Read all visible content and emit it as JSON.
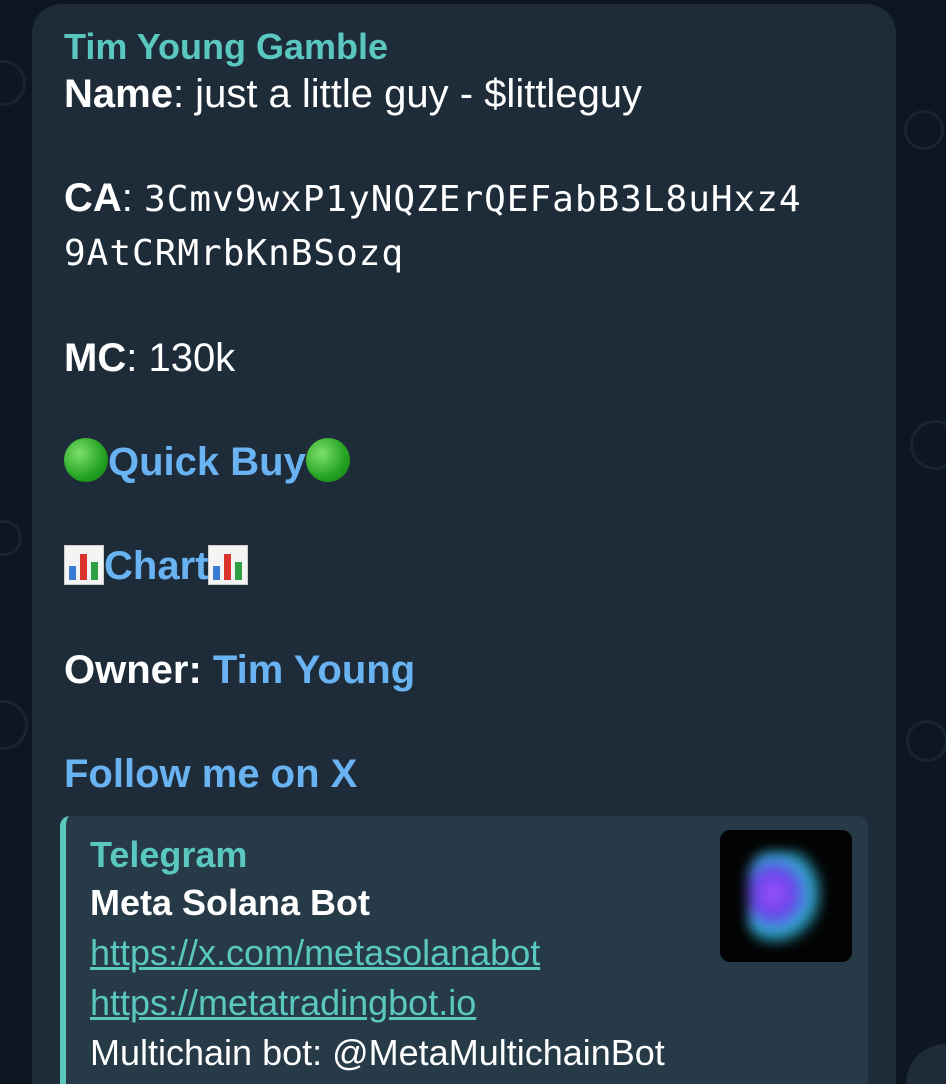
{
  "message": {
    "sender": "Tim Young Gamble",
    "name_label": "Name",
    "name_value": ": just a little guy - $littleguy",
    "ca_label": "CA",
    "ca_sep": ": ",
    "ca_line1": "3Cmv9wxP1yNQZErQEFabB3L8uHxz4",
    "ca_line2": "9AtCRMrbKnBSozq",
    "mc_label": "MC",
    "mc_value": ": 130k",
    "quick_buy": "Quick Buy",
    "chart": "Chart",
    "owner_label": "Owner: ",
    "owner_link": "Tim Young",
    "follow_link": "Follow me on X"
  },
  "preview": {
    "site": "Telegram",
    "title": "Meta Solana Bot",
    "link1": "https://x.com/metasolanabot",
    "link2": "https://metatradingbot.io",
    "text": "Multichain bot: @MetaMultichainBot"
  },
  "icons": {
    "quick_buy": "green-circle-icon",
    "chart": "bar-chart-icon"
  },
  "colors": {
    "background": "#0e1621",
    "bubble": "#1e2c3a",
    "accent": "#5bc8c0",
    "link": "#6ab3f3"
  }
}
